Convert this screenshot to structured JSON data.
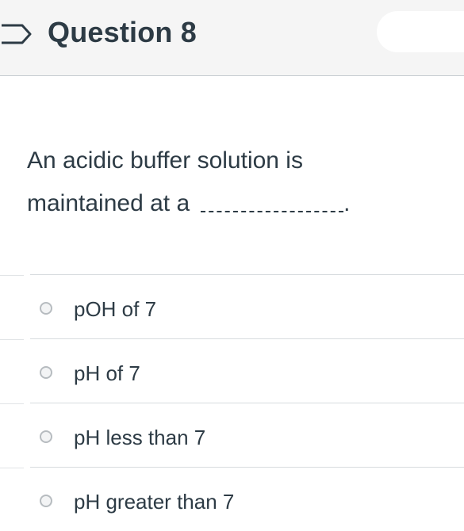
{
  "question": {
    "title": "Question 8",
    "text_line1": "An acidic buffer solution is",
    "text_line2": "maintained at a",
    "text_end": "."
  },
  "answers": [
    {
      "label": "pOH of 7"
    },
    {
      "label": "pH of 7"
    },
    {
      "label": "pH less than 7"
    },
    {
      "label": "pH greater than 7"
    }
  ],
  "icons": {
    "flag": "flag-icon",
    "radio": "radio-icon"
  },
  "colors": {
    "text": "#2d3b45",
    "header_bg": "#f5f5f5",
    "divider": "#d7dbde"
  }
}
